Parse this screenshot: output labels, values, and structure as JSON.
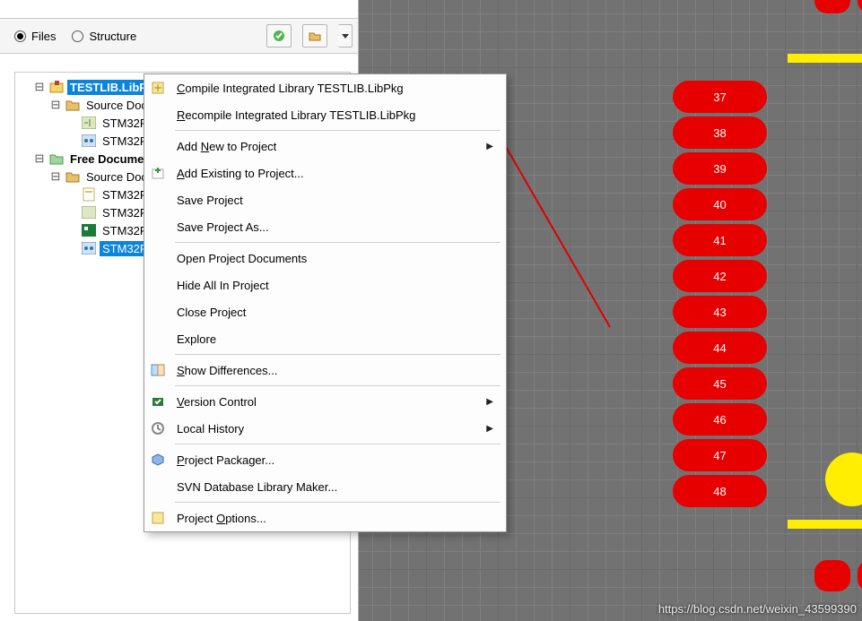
{
  "controls": {
    "radio_files": "Files",
    "radio_structure": "Structure"
  },
  "tree": {
    "project": "TESTLIB.LibPkg",
    "src_docs": "Source Documents",
    "file_a": "STM32F10",
    "file_b": "STM32F10",
    "free_docs": "Free Documents",
    "src_docs2": "Source Docum",
    "free_a": "STM32F10",
    "free_b": "STM32F10",
    "free_c": "STM32F10",
    "free_sel": "STM32F10"
  },
  "menu": {
    "compile": {
      "pre": "",
      "u": "C",
      "post": "ompile Integrated Library TESTLIB.LibPkg"
    },
    "recompile": {
      "pre": "",
      "u": "R",
      "post": "ecompile Integrated Library TESTLIB.LibPkg"
    },
    "add_new": {
      "pre": "Add ",
      "u": "N",
      "post": "ew to Project"
    },
    "add_ex": {
      "pre": "",
      "u": "A",
      "post": "dd Existing to Project..."
    },
    "save": "Save Project",
    "save_as": "Save Project As...",
    "open_docs": "Open Project Documents",
    "hide_all": "Hide All In Project",
    "close": "Close Project",
    "explore": "Explore",
    "show_diff": {
      "pre": "",
      "u": "S",
      "post": "how Differences..."
    },
    "vcs": {
      "pre": "",
      "u": "V",
      "post": "ersion Control"
    },
    "local_hist": "Local History",
    "packager": {
      "pre": "",
      "u": "P",
      "post": "roject Packager..."
    },
    "svn_maker": "SVN Database Library Maker...",
    "options": {
      "pre": "Project ",
      "u": "O",
      "post": "ptions..."
    }
  },
  "pads": [
    "37",
    "38",
    "39",
    "40",
    "41",
    "42",
    "43",
    "44",
    "45",
    "46",
    "47",
    "48"
  ],
  "watermark": "https://blog.csdn.net/weixin_43599390"
}
